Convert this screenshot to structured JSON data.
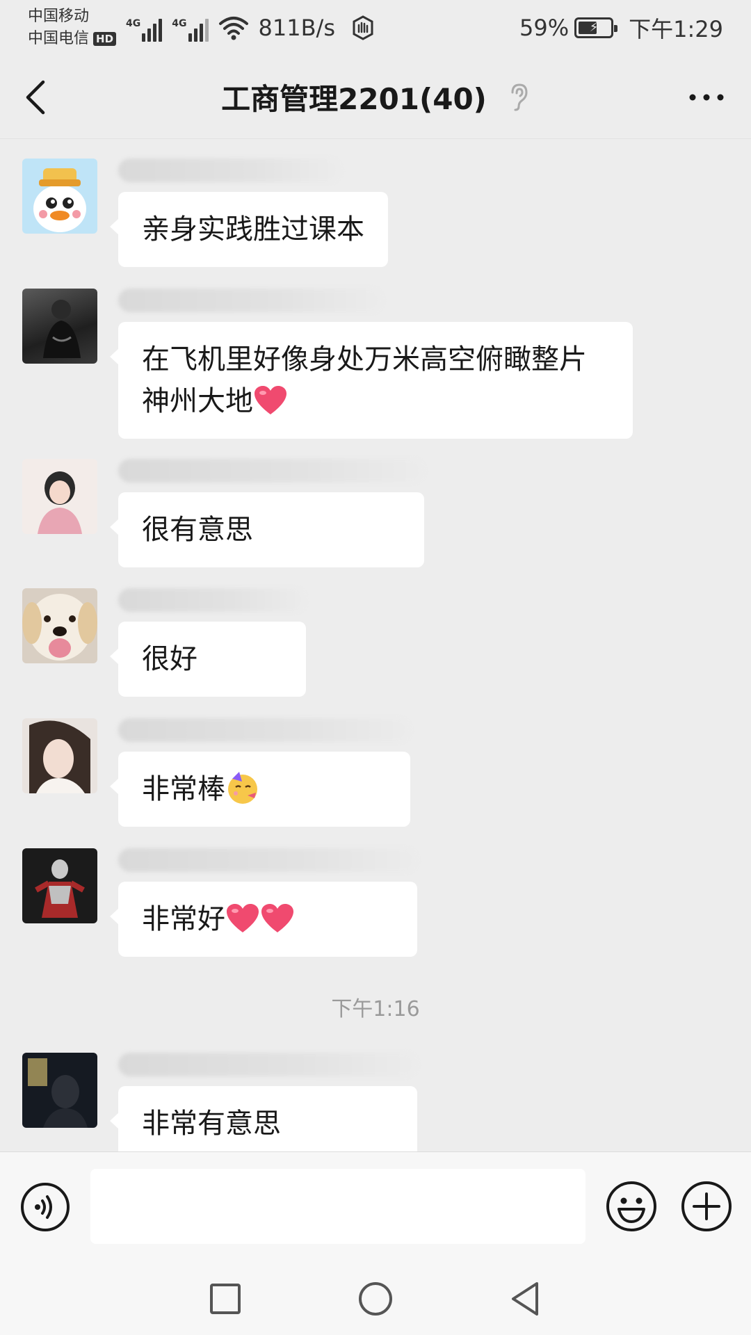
{
  "status_bar": {
    "carrier_1": "中国移动",
    "carrier_2": "中国电信",
    "hd_badge": "HD",
    "signal_1_label": "4G",
    "signal_2_label": "4G",
    "net_speed": "811B/s",
    "battery_percent": "59%",
    "battery_level": 0.59,
    "time": "下午1:29"
  },
  "header": {
    "title": "工商管理2201(40)",
    "icons": [
      "back-icon",
      "ear-icon",
      "more-icon"
    ]
  },
  "messages": [
    {
      "text": "亲身实践胜过课本",
      "emoji": []
    },
    {
      "text": "在飞机里好像身处万米高空俯瞰整片神州大地",
      "emoji": [
        "heart"
      ]
    },
    {
      "text": "很有意思",
      "emoji": []
    },
    {
      "text": "很好",
      "emoji": []
    },
    {
      "text": "非常棒",
      "emoji": [
        "partying-face"
      ]
    },
    {
      "text": "非常好",
      "emoji": [
        "heart",
        "heart"
      ]
    },
    {
      "text": "非常有意思",
      "emoji": []
    }
  ],
  "time_separator": "下午1:16",
  "input_bar": {
    "placeholder": "",
    "icons": [
      "voice-icon",
      "emoji-icon",
      "plus-icon"
    ]
  },
  "nav_bar": {
    "icons": [
      "recents-icon",
      "home-icon",
      "back-triangle-icon"
    ]
  },
  "colors": {
    "background": "#ededed",
    "bubble": "#ffffff",
    "heart": "#f04a6f"
  }
}
